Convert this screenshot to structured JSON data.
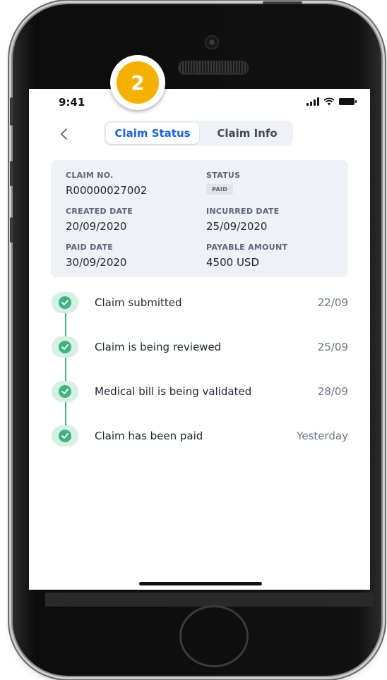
{
  "step_badge": "2",
  "status_bar": {
    "time": "9:41"
  },
  "header": {
    "tabs": [
      {
        "label": "Claim Status",
        "active": true
      },
      {
        "label": "Claim Info",
        "active": false
      }
    ]
  },
  "claim": {
    "claim_no_label": "CLAIM NO.",
    "claim_no": "R00000027002",
    "status_label": "STATUS",
    "status": "PAID",
    "created_label": "CREATED DATE",
    "created": "20/09/2020",
    "incurred_label": "INCURRED DATE",
    "incurred": "25/09/2020",
    "paid_label": "PAID DATE",
    "paid": "30/09/2020",
    "amount_label": "PAYABLE AMOUNT",
    "amount": "4500 USD"
  },
  "timeline": [
    {
      "label": "Claim submitted",
      "date": "22/09"
    },
    {
      "label": "Claim is being reviewed",
      "date": "25/09"
    },
    {
      "label": "Medical bill is being validated",
      "date": "28/09"
    },
    {
      "label": "Claim has been paid",
      "date": "Yesterday"
    }
  ],
  "colors": {
    "accent_blue": "#1b63d6",
    "success_green": "#3fb37f",
    "badge_orange": "#f5b000"
  }
}
